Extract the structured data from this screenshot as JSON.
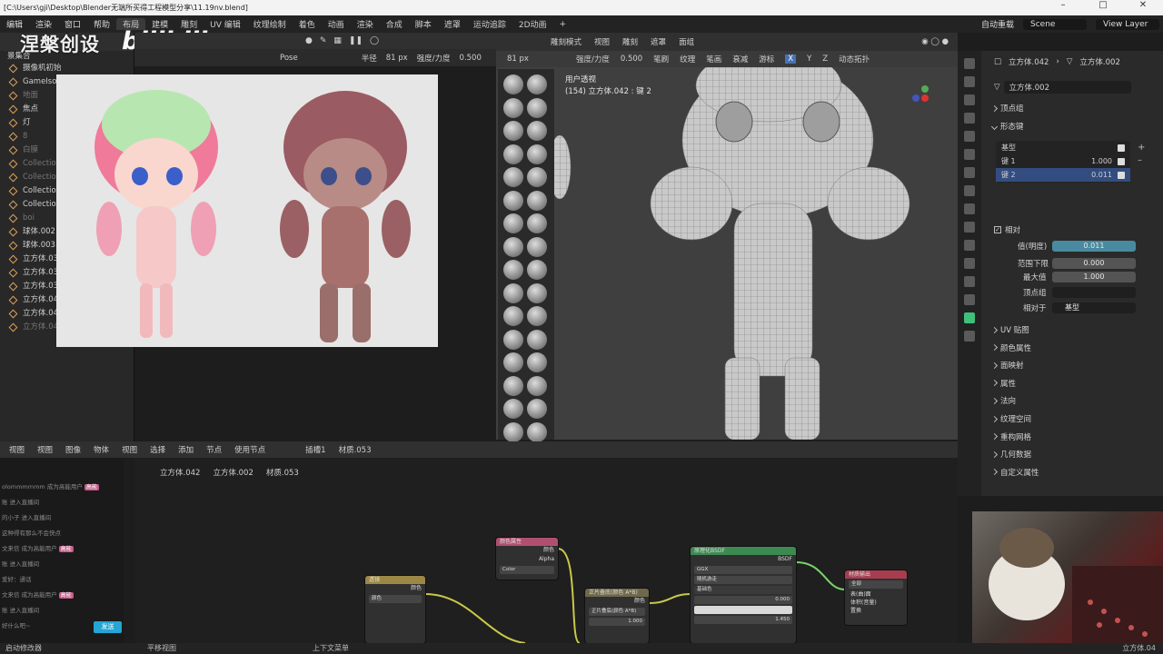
{
  "titlebar": {
    "path": "[C:\\Users\\gji\\Desktop\\Blender无端所买得工程模型分享\\11.19nv.blend]"
  },
  "menubar": {
    "menus": [
      "编辑",
      "渲染",
      "窗口",
      "帮助"
    ],
    "tabs": [
      "布局",
      "建模",
      "雕刻",
      "UV 编辑",
      "纹理绘制",
      "着色",
      "动画",
      "渲染",
      "合成",
      "脚本",
      "遮罩",
      "运动追踪",
      "2D动画"
    ],
    "active_tab_index": 0,
    "render_engine": "自动重载",
    "scene": "Scene",
    "view_layer": "View Layer"
  },
  "logo": {
    "text": "涅槃创设",
    "brand": "bilibili"
  },
  "outliner": {
    "header": "景集合",
    "rows": [
      {
        "label": "摄像机初始",
        "dim": false
      },
      {
        "label": "GameIsoCa",
        "dim": false
      },
      {
        "label": "地面",
        "dim": true
      },
      {
        "label": "焦点",
        "dim": false
      },
      {
        "label": "灯",
        "dim": false
      },
      {
        "label": "8",
        "dim": true
      },
      {
        "label": "白膜",
        "dim": true
      },
      {
        "label": "Collection 4",
        "dim": true
      },
      {
        "label": "Collection 5",
        "dim": true
      },
      {
        "label": "Collection 6",
        "dim": false
      },
      {
        "label": "Collection 7",
        "dim": false
      },
      {
        "label": "boi",
        "dim": true
      },
      {
        "label": "球体.002",
        "dim": false
      },
      {
        "label": "球体.003",
        "dim": false
      },
      {
        "label": "立方体.034",
        "dim": false
      },
      {
        "label": "立方体.036",
        "dim": false
      },
      {
        "label": "立方体.039",
        "dim": false
      },
      {
        "label": "立方体.040",
        "dim": false
      },
      {
        "label": "立方体.041",
        "dim": false
      },
      {
        "label": "立方体.043",
        "dim": true
      }
    ]
  },
  "sculpt_header": {
    "pose": "Pose",
    "radius_label": "半径",
    "radius_value": "81 px",
    "strength_label": "强度/力度",
    "strength_value": "0.500"
  },
  "viewport_header": {
    "mode": "雕刻模式",
    "menus": [
      "视图",
      "雕刻",
      "遮罩",
      "面组"
    ],
    "radius_value": "81 px",
    "strength_label": "强度/力度",
    "strength_value": "0.500",
    "items": [
      "笔刷",
      "纹理",
      "笔画",
      "衰减",
      "游标"
    ],
    "axes": [
      "X",
      "Y",
      "Z"
    ],
    "dyntopo": "动态拓扑"
  },
  "viewport": {
    "view_name": "用户透视",
    "object_info": "(154) 立方体.042 : 键 2"
  },
  "properties": {
    "breadcrumb_obj": "立方体.042",
    "breadcrumb_mesh": "立方体.002",
    "mesh_name": "立方体.002",
    "sections_top": [
      "顶点组",
      "形态键"
    ],
    "shape_keys": [
      {
        "name": "基型",
        "value": ""
      },
      {
        "name": "键 1",
        "value": "1.000"
      },
      {
        "name": "键 2",
        "value": "0.011"
      }
    ],
    "relative_label": "相对",
    "value_label": "值(明度)",
    "value": "0.011",
    "range_min_label": "范围下限",
    "range_min": "0.000",
    "max_label": "最大值",
    "max": "1.000",
    "vertex_group_label": "顶点组",
    "relative_to_label": "相对于",
    "relative_to": "基型",
    "sections_bottom": [
      "UV 贴图",
      "颜色属性",
      "面映射",
      "属性",
      "法向",
      "纹理空间",
      "重构网格",
      "几何数据",
      "自定义属性"
    ]
  },
  "node_header": {
    "menus": [
      "视图",
      "视图",
      "图像"
    ],
    "object_label": "物体",
    "menus2": [
      "视图",
      "选择",
      "添加",
      "节点"
    ],
    "use_nodes": "使用节点",
    "slot": "插槽1",
    "material": "材质.053"
  },
  "node_breadcrumb": {
    "obj": "立方体.042",
    "mesh": "立方体.002",
    "mat": "材质.053"
  },
  "nodes": {
    "color_attr": {
      "title": "颜色属性",
      "out1": "颜色",
      "out2": "Alpha",
      "field": "Color"
    },
    "texture": {
      "title": "透镜",
      "mode": "颜色",
      "field": "颜色"
    },
    "mix": {
      "title": "正片叠底(颜色 A*B)",
      "out": "颜色",
      "blend": "正片叠底(颜色 A*B)",
      "factor": "1.000"
    },
    "bsdf": {
      "title": "原理化BSDF",
      "out": "BSDF",
      "dist": "GGX",
      "sss": "随机游走",
      "base": "基础色",
      "v1": "0.000",
      "ior": "1.450"
    },
    "output": {
      "title": "材质输出",
      "target": "全部",
      "in1": "表(曲)面",
      "in2": "体积(音量)",
      "in3": "置换"
    }
  },
  "chat": {
    "lines": [
      {
        "t": "olommmmmm 成为高能用户",
        "badge": "高能"
      },
      {
        "t": "账 进入直播间",
        "badge": ""
      },
      {
        "t": "的小子 进入直播间",
        "badge": ""
      },
      {
        "t": "这种得有那么不会快点",
        "badge": ""
      },
      {
        "t": "文来信 成为高能用户",
        "badge": "高能"
      },
      {
        "t": "账 进入直播间",
        "badge": ""
      },
      {
        "t": "爱好：通话",
        "badge": ""
      },
      {
        "t": "文来信 成为高能用户",
        "badge": "高能"
      },
      {
        "t": "账 进入直播间",
        "badge": ""
      },
      {
        "t": "好什么吧~",
        "badge": ""
      }
    ],
    "send_button": "发送"
  },
  "statusbar": {
    "left": "启动修改器",
    "mid": "平移视图",
    "mid2": "上下文菜单",
    "right": "立方体.04"
  }
}
